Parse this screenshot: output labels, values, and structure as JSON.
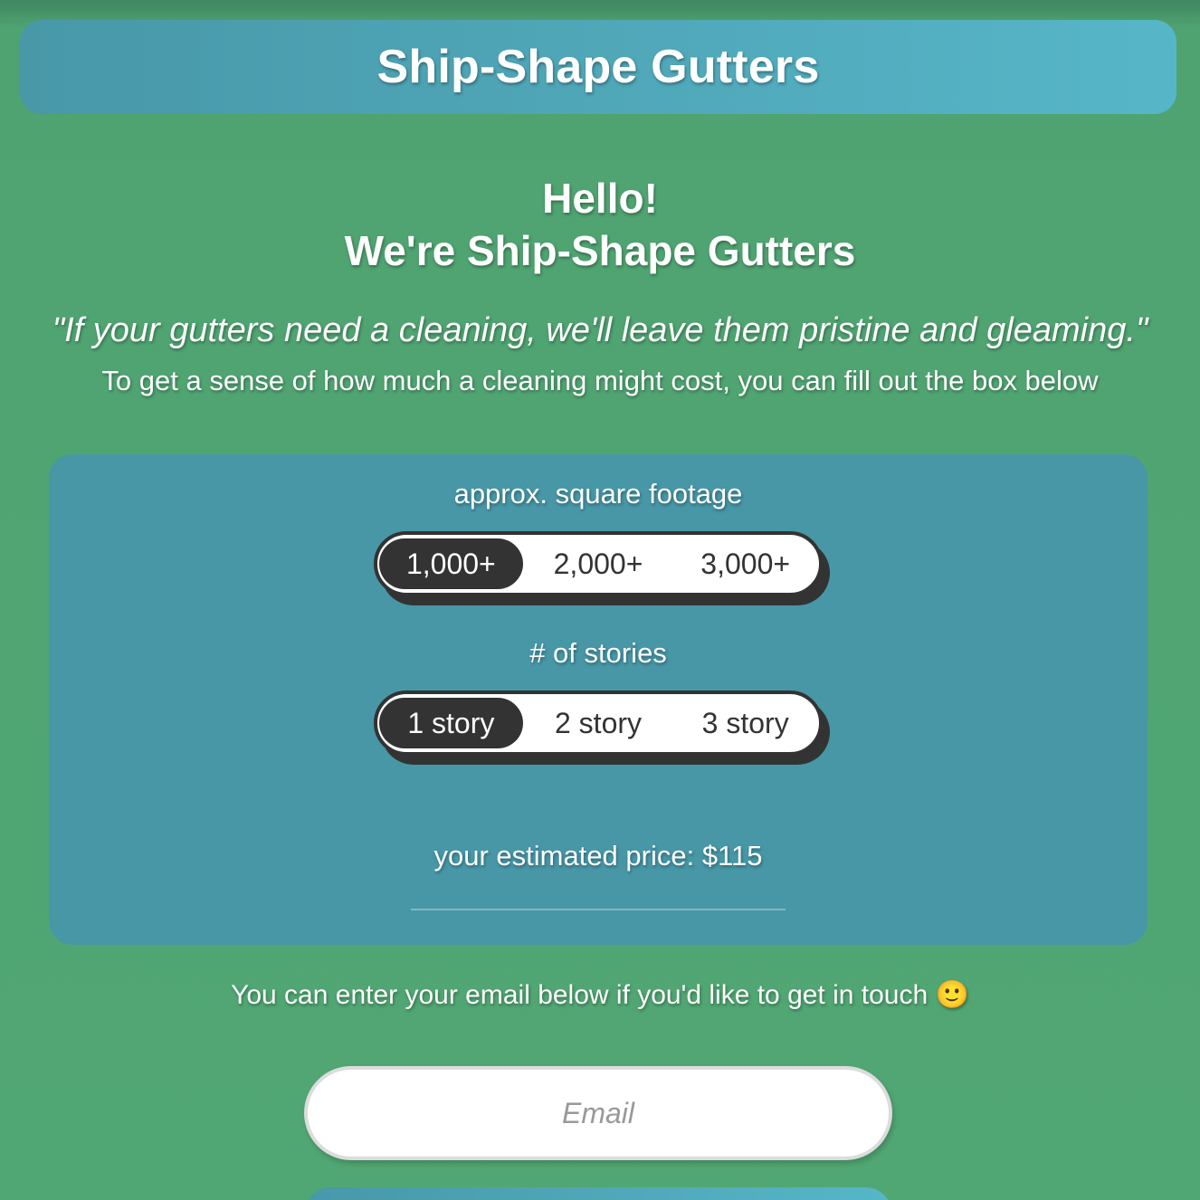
{
  "header": {
    "title": "Ship-Shape Gutters"
  },
  "intro": {
    "line1": "Hello!",
    "line2": "We're Ship-Shape Gutters",
    "quote": "\"If your gutters need a cleaning, we'll leave them pristine and gleaming.\"",
    "subtitle": "To get a sense of how much a cleaning might cost, you can fill out the box below"
  },
  "calculator": {
    "footage": {
      "label": "approx. square footage",
      "options": [
        "1,000+",
        "2,000+",
        "3,000+"
      ],
      "selected": "1,000+"
    },
    "stories": {
      "label": "# of stories",
      "options": [
        "1 story",
        "2 story",
        "3 story"
      ],
      "selected": "1 story"
    },
    "price_text": "your estimated price: $115"
  },
  "contact": {
    "text": "You can enter your email below if you'd like to get in touch",
    "emoji": "🙂",
    "email_placeholder": "Email",
    "email_value": ""
  },
  "colors": {
    "background": "#51a773",
    "header": "#4898a8",
    "panel": "#4797a7",
    "selected": "#333333"
  }
}
